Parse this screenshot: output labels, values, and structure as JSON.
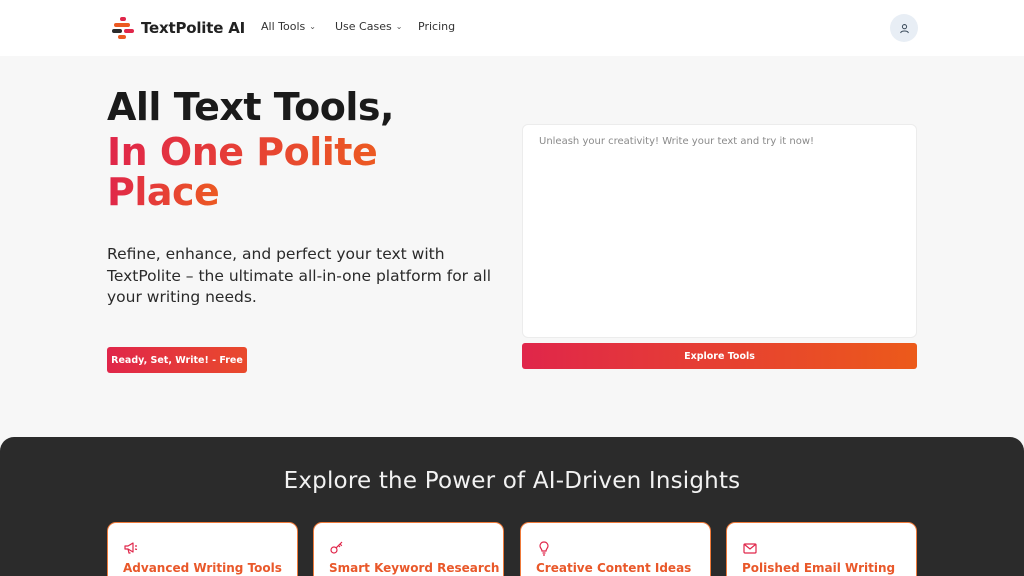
{
  "header": {
    "brand": "TextPolite AI",
    "nav": [
      {
        "label": "All Tools",
        "has_dropdown": true
      },
      {
        "label": "Use Cases",
        "has_dropdown": true
      },
      {
        "label": "Pricing",
        "has_dropdown": false
      }
    ],
    "user_icon": "user-icon"
  },
  "hero": {
    "title_line1": "All Text Tools,",
    "title_line2": "In One Polite",
    "title_line3": "Place",
    "subtitle": "Refine, enhance, and perfect your text with TextPolite – the ultimate all-in-one platform for all your writing needs.",
    "cta_label": "Ready, Set, Write! - Free"
  },
  "editor": {
    "placeholder": "Unleash your creativity! Write your text and try it now!",
    "value": "",
    "button_label": "Explore Tools"
  },
  "features": {
    "title": "Explore the Power of AI-Driven Insights",
    "cards": [
      {
        "icon": "megaphone-icon",
        "title": "Advanced Writing Tools"
      },
      {
        "icon": "key-icon",
        "title": "Smart Keyword Research"
      },
      {
        "icon": "lightbulb-icon",
        "title": "Creative Content Ideas"
      },
      {
        "icon": "envelope-icon",
        "title": "Polished Email Writing"
      }
    ]
  },
  "colors": {
    "accent_start": "#e0264a",
    "accent_end": "#ec5a1a",
    "dark_section": "#2b2b2b"
  }
}
